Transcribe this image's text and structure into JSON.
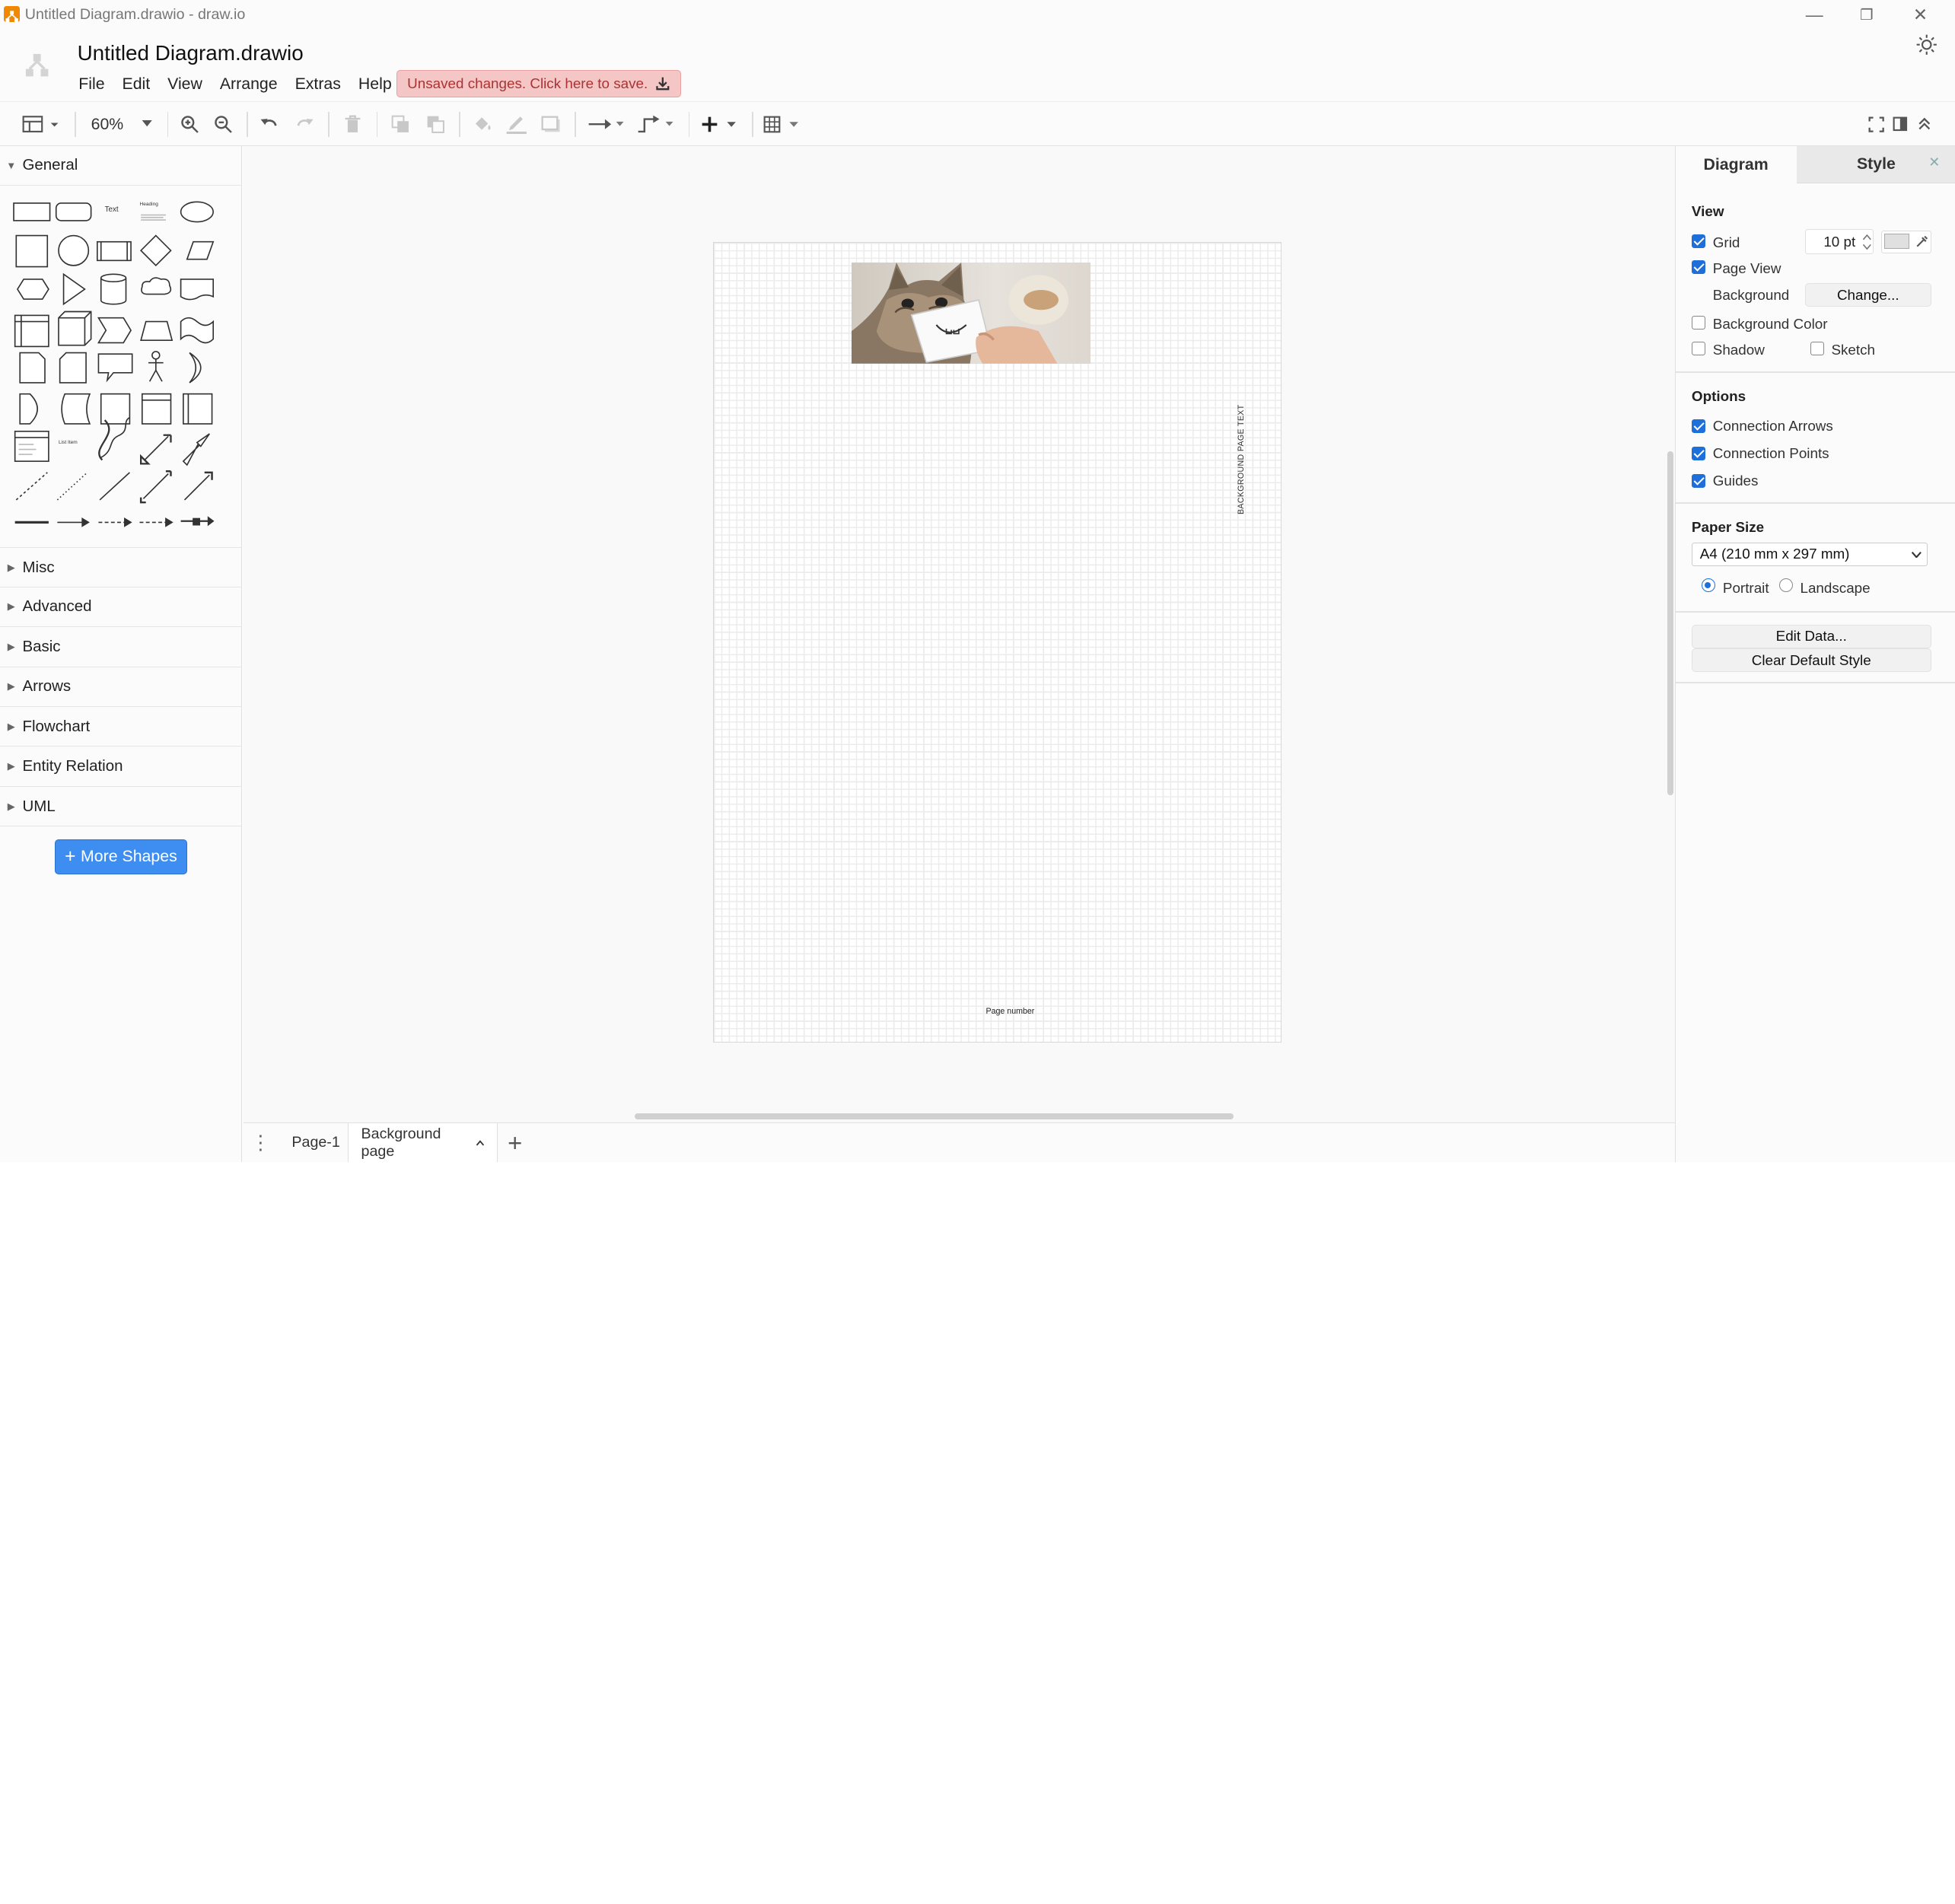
{
  "window": {
    "title": "Untitled Diagram.drawio - draw.io",
    "minimize_glyph": "—",
    "maximize_glyph": "❐",
    "close_glyph": "✕"
  },
  "header": {
    "doc_name": "Untitled Diagram.drawio",
    "menu": [
      "File",
      "Edit",
      "View",
      "Arrange",
      "Extras",
      "Help"
    ],
    "unsaved_text": "Unsaved changes. Click here to save."
  },
  "toolbar": {
    "zoom": "60%"
  },
  "sidebar": {
    "general_label": "General",
    "shape_texts": {
      "text": "Text",
      "heading": "Heading",
      "list_item": "List Item"
    },
    "sections": [
      "Misc",
      "Advanced",
      "Basic",
      "Arrows",
      "Flowchart",
      "Entity Relation",
      "UML"
    ],
    "more_shapes": "More Shapes",
    "more_shapes_glyph": "+"
  },
  "canvas": {
    "vertical_text": "BACKGROUND PAGE TEXT",
    "page_number": "Page number"
  },
  "pages": {
    "tabs": [
      "Page-1",
      "Background page"
    ],
    "active_index": 1,
    "add_glyph": "+",
    "menu_glyph": "⋮"
  },
  "format_panel": {
    "tab_diagram": "Diagram",
    "tab_style": "Style",
    "close_glyph": "✕",
    "view_header": "View",
    "grid_label": "Grid",
    "grid_checked": true,
    "grid_size": "10 pt",
    "grid_color": "#e0e0e0",
    "page_view_label": "Page View",
    "page_view_checked": true,
    "background_label": "Background",
    "change_button": "Change...",
    "background_color_label": "Background Color",
    "background_color_checked": false,
    "shadow_label": "Shadow",
    "shadow_checked": false,
    "sketch_label": "Sketch",
    "sketch_checked": false,
    "options_header": "Options",
    "connection_arrows_label": "Connection Arrows",
    "connection_arrows_checked": true,
    "connection_points_label": "Connection Points",
    "connection_points_checked": true,
    "guides_label": "Guides",
    "guides_checked": true,
    "paper_size_header": "Paper Size",
    "paper_size_value": "A4 (210 mm x 297 mm)",
    "portrait_label": "Portrait",
    "landscape_label": "Landscape",
    "orientation": "Portrait",
    "edit_data_button": "Edit Data...",
    "clear_default_style_button": "Clear Default Style"
  },
  "colors": {
    "accent": "#1e6fd9",
    "more_shapes_bg": "#3d8ef0",
    "unsaved_bg": "#f5c6c6",
    "unsaved_text": "#a33333"
  }
}
